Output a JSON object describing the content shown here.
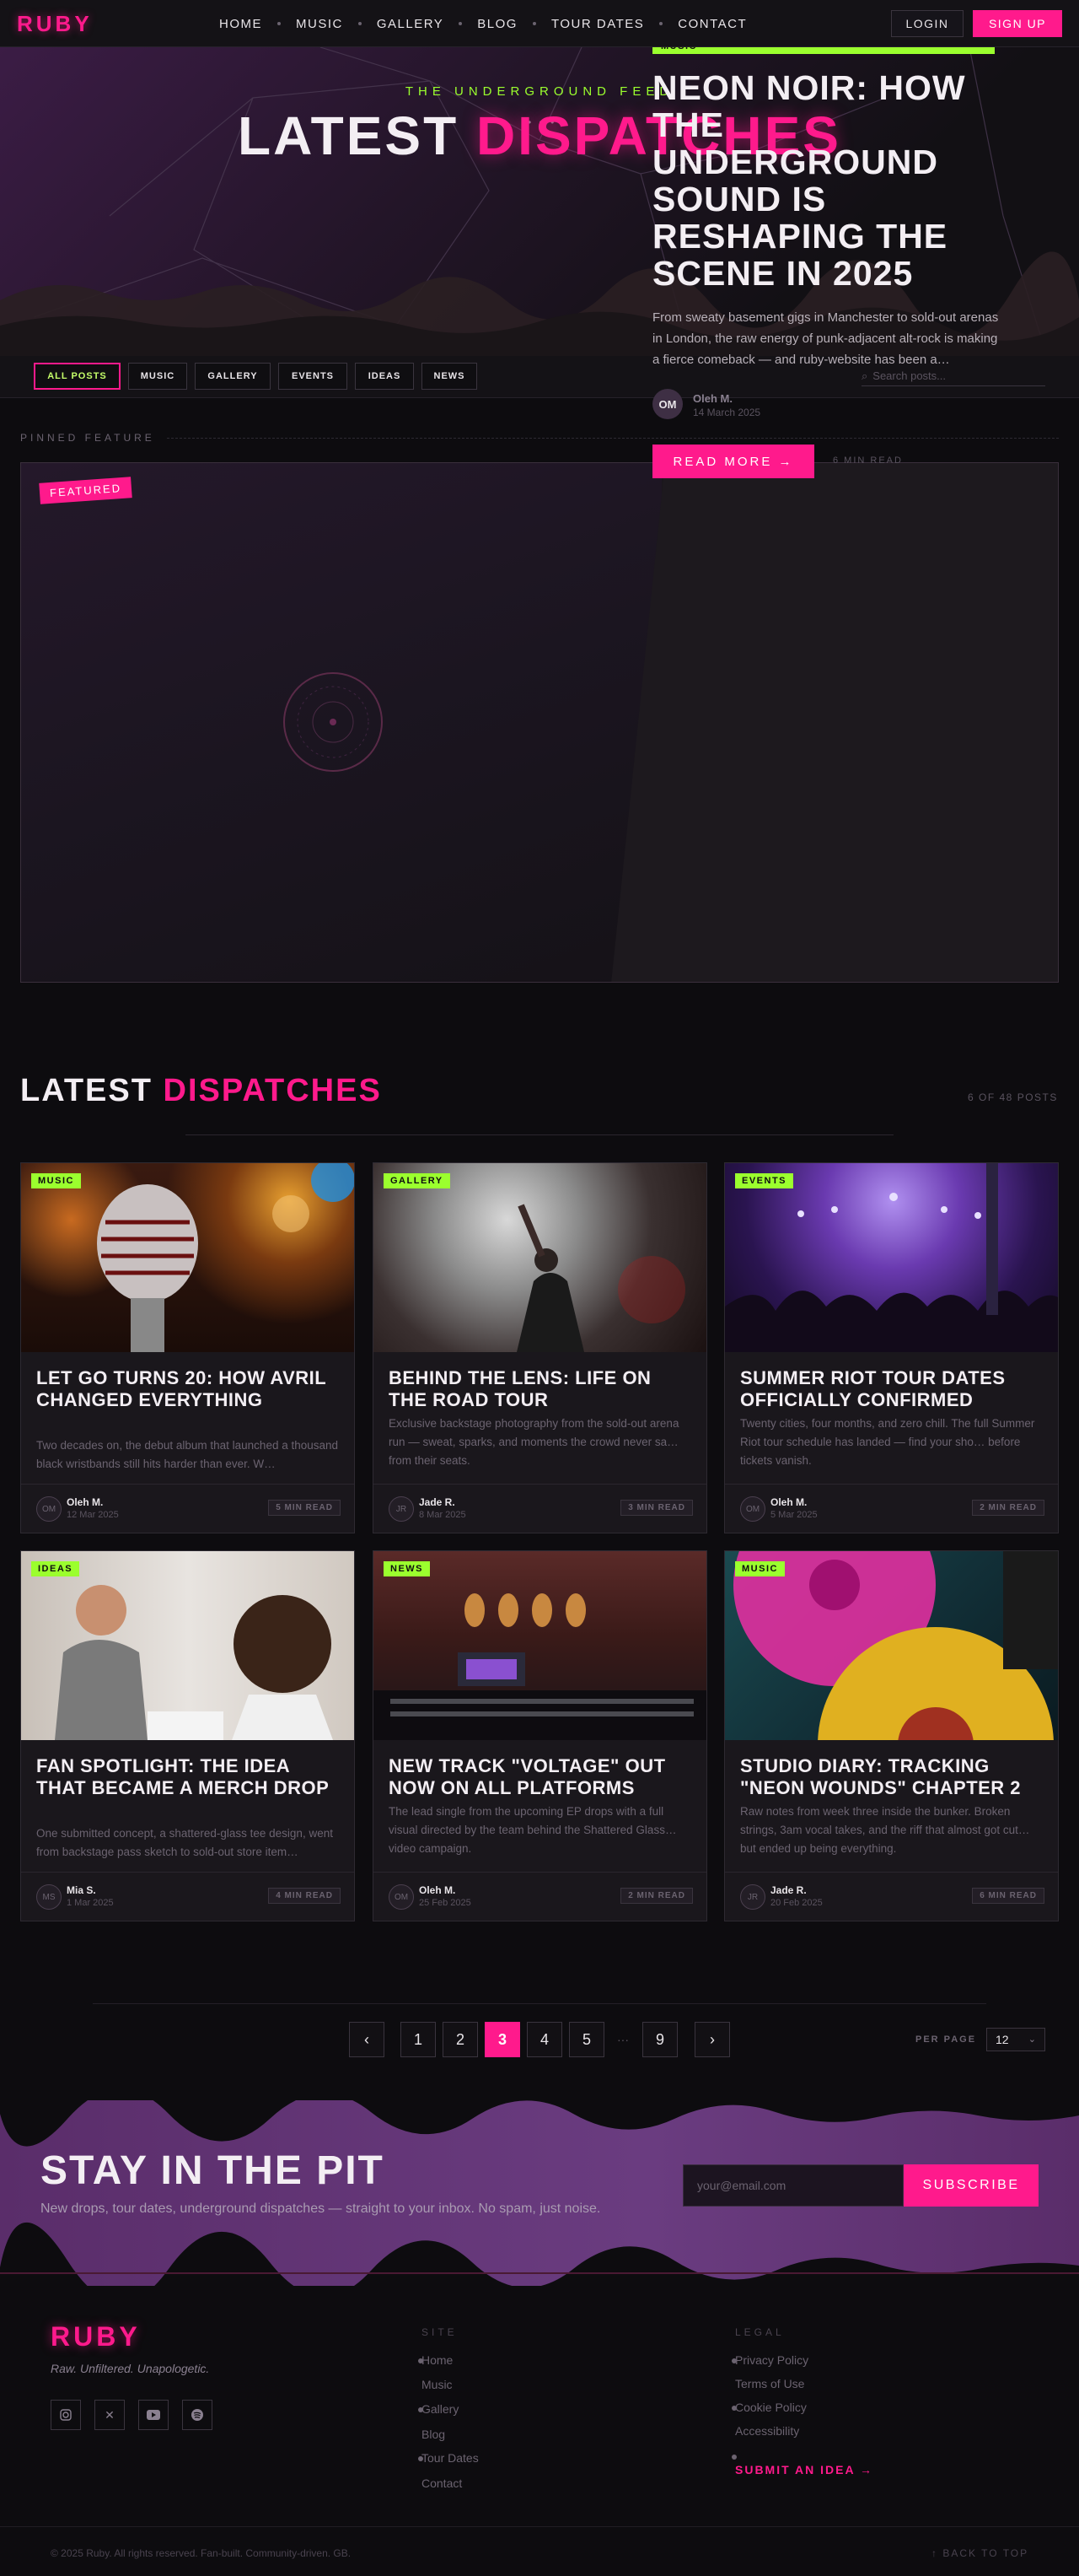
{
  "brand": {
    "name": "RUBY",
    "accent": "#ff1a8c",
    "lime": "#9bff2e"
  },
  "nav": {
    "items": [
      {
        "label": "HOME"
      },
      {
        "label": "MUSIC"
      },
      {
        "label": "GALLERY"
      },
      {
        "label": "BLOG"
      },
      {
        "label": "TOUR DATES"
      },
      {
        "label": "CONTACT"
      }
    ],
    "login": "LOGIN",
    "signup": "SIGN UP"
  },
  "hero": {
    "dots": "• • •",
    "kicker": "THE UNDERGROUND FEED",
    "title_a": "LATEST",
    "title_b": "DISPATCHES"
  },
  "filters": {
    "chips": [
      "ALL POSTS",
      "MUSIC",
      "GALLERY",
      "EVENTS",
      "IDEAS",
      "NEWS"
    ],
    "active": "ALL POSTS",
    "search_placeholder": "Search posts..."
  },
  "pinned": {
    "label": "PINNED FEATURE",
    "badge": "FEATURED",
    "category": "MUSIC",
    "title": "NEON NOIR: HOW THE UNDERGROUND SOUND IS RESHAPING THE SCENE IN 2025",
    "excerpt": "From sweaty basement gigs in Manchester to sold-out arenas in London, the raw energy of punk-adjacent alt-rock is making a fierce comeback — and ruby-website has been a…",
    "author_initials": "OM",
    "author": "Oleh M.",
    "date": "14 March 2025",
    "read_more": "READ MORE →",
    "read_time": "6 MIN READ"
  },
  "latest": {
    "title_a": "LATEST",
    "title_b": "DISPATCHES",
    "count": "6 OF 48 POSTS"
  },
  "posts": [
    {
      "category": "MUSIC",
      "title": "LET GO TURNS 20: HOW AVRIL CHANGED EVERYTHING",
      "excerpt": "Two decades on, the debut album that launched a thousand black wristbands still hits harder than ever. W…",
      "initials": "OM",
      "author": "Oleh M.",
      "date": "12 Mar 2025",
      "read": "5 MIN READ",
      "image": "microphone-photo"
    },
    {
      "category": "GALLERY",
      "title": "BEHIND THE LENS: LIFE ON THE ROAD TOUR",
      "excerpt": "Exclusive backstage photography from the sold-out arena run — sweat, sparks, and moments the crowd never sa… from their seats.",
      "initials": "JR",
      "author": "Jade R.",
      "date": "8 Mar 2025",
      "read": "3 MIN READ",
      "image": "stage-performer-photo"
    },
    {
      "category": "EVENTS",
      "title": "SUMMER RIOT TOUR DATES OFFICIALLY CONFIRMED",
      "excerpt": "Twenty cities, four months, and zero chill. The full Summer Riot tour schedule has landed — find your sho… before tickets vanish.",
      "initials": "OM",
      "author": "Oleh M.",
      "date": "5 Mar 2025",
      "read": "2 MIN READ",
      "image": "concert-crowd-photo"
    },
    {
      "category": "IDEAS",
      "title": "FAN SPOTLIGHT: THE IDEA THAT BECAME A MERCH DROP",
      "excerpt": "One submitted concept, a shattered-glass tee design, went from backstage pass sketch to sold-out store item…",
      "initials": "MS",
      "author": "Mia S.",
      "date": "1 Mar 2025",
      "read": "4 MIN READ",
      "image": "meeting-photo"
    },
    {
      "category": "NEWS",
      "title": "NEW TRACK \"VOLTAGE\" OUT NOW ON ALL PLATFORMS",
      "excerpt": "The lead single from the upcoming EP drops with a full visual directed by the team behind the Shattered Glass… video campaign.",
      "initials": "OM",
      "author": "Oleh M.",
      "date": "25 Feb 2025",
      "read": "2 MIN READ",
      "image": "studio-photo"
    },
    {
      "category": "MUSIC",
      "title": "STUDIO DIARY: TRACKING \"NEON WOUNDS\" CHAPTER 2",
      "excerpt": "Raw notes from week three inside the bunker. Broken strings, 3am vocal takes, and the riff that almost got cut… but ended up being everything.",
      "initials": "JR",
      "author": "Jade R.",
      "date": "20 Feb 2025",
      "read": "6 MIN READ",
      "image": "vinyl-records-photo"
    }
  ],
  "pagination": {
    "prev": "‹",
    "next": "›",
    "pages": [
      "1",
      "2",
      "3",
      "4",
      "5"
    ],
    "current": "3",
    "ellipsis": "···",
    "last": "9",
    "per_page_label": "PER PAGE",
    "per_page": "12"
  },
  "newsletter": {
    "title": "STAY IN THE PIT",
    "subtitle": "New drops, tour dates, underground dispatches — straight to your inbox. No spam, just noise.",
    "placeholder": "your@email.com",
    "button": "SUBSCRIBE"
  },
  "footer": {
    "logo": "RUBY",
    "tagline": "Raw. Unfiltered. Unapologetic.",
    "social": [
      "instagram-icon",
      "x-icon",
      "youtube-icon",
      "spotify-icon"
    ],
    "site_head": "SITE",
    "site_links": [
      "Home",
      "Music",
      "Gallery",
      "Blog",
      "Tour Dates",
      "Contact"
    ],
    "legal_head": "LEGAL",
    "legal_links": [
      "Privacy Policy",
      "Terms of Use",
      "Cookie Policy",
      "Accessibility"
    ],
    "submit_idea": "SUBMIT AN IDEA →",
    "copyright": "© 2025 Ruby. All rights reserved. Fan-built. Community-driven. GB.",
    "back_to_top": "↑ BACK TO TOP"
  }
}
